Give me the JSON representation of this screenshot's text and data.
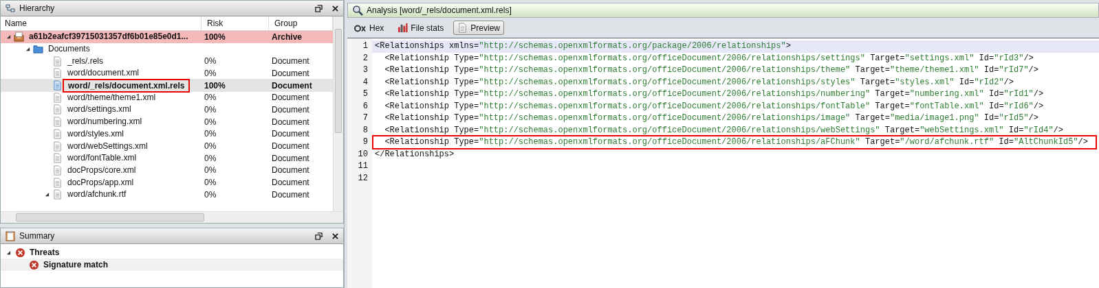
{
  "hierarchy": {
    "title": "Hierarchy",
    "columns": [
      "Name",
      "Risk",
      "Group"
    ],
    "rows": [
      {
        "name": "a61b2eafcf39715031357df6b01e85e0d1...",
        "risk": "100%",
        "group": "Archive",
        "kind": "archive",
        "alert": true,
        "selected": false,
        "highlighted": false,
        "expanded": true,
        "children": [
          {
            "name": "Documents",
            "kind": "folder",
            "alert": false,
            "selected": false,
            "highlighted": false,
            "expanded": true,
            "children": [
              {
                "name": "_rels/.rels",
                "risk": "0%",
                "group": "Document",
                "kind": "file",
                "alert": false,
                "selected": false,
                "highlighted": false
              },
              {
                "name": "word/document.xml",
                "risk": "0%",
                "group": "Document",
                "kind": "file",
                "alert": false,
                "selected": false,
                "highlighted": false
              },
              {
                "name": "word/_rels/document.xml.rels",
                "risk": "100%",
                "group": "Document",
                "kind": "file",
                "alert": false,
                "selected": true,
                "highlighted": true
              },
              {
                "name": "word/theme/theme1.xml",
                "risk": "0%",
                "group": "Document",
                "kind": "file",
                "alert": false,
                "selected": false,
                "highlighted": false
              },
              {
                "name": "word/settings.xml",
                "risk": "0%",
                "group": "Document",
                "kind": "file",
                "alert": false,
                "selected": false,
                "highlighted": false
              },
              {
                "name": "word/numbering.xml",
                "risk": "0%",
                "group": "Document",
                "kind": "file",
                "alert": false,
                "selected": false,
                "highlighted": false
              },
              {
                "name": "word/styles.xml",
                "risk": "0%",
                "group": "Document",
                "kind": "file",
                "alert": false,
                "selected": false,
                "highlighted": false
              },
              {
                "name": "word/webSettings.xml",
                "risk": "0%",
                "group": "Document",
                "kind": "file",
                "alert": false,
                "selected": false,
                "highlighted": false
              },
              {
                "name": "word/fontTable.xml",
                "risk": "0%",
                "group": "Document",
                "kind": "file",
                "alert": false,
                "selected": false,
                "highlighted": false
              },
              {
                "name": "docProps/core.xml",
                "risk": "0%",
                "group": "Document",
                "kind": "file",
                "alert": false,
                "selected": false,
                "highlighted": false
              },
              {
                "name": "docProps/app.xml",
                "risk": "0%",
                "group": "Document",
                "kind": "file",
                "alert": false,
                "selected": false,
                "highlighted": false
              },
              {
                "name": "word/afchunk.rtf",
                "risk": "0%",
                "group": "Document",
                "kind": "file",
                "alert": false,
                "selected": false,
                "highlighted": false,
                "expanded": true
              }
            ]
          }
        ]
      }
    ]
  },
  "summary": {
    "title": "Summary",
    "items": [
      {
        "label": "Threats",
        "expanded": true,
        "selected": false,
        "children": [
          {
            "label": "Signature match",
            "selected": true
          }
        ]
      }
    ]
  },
  "analysis": {
    "title": "Analysis [word/_rels/document.xml.rels]",
    "tools": [
      {
        "label": "Hex",
        "kind": "hex",
        "selected": false
      },
      {
        "label": "File stats",
        "kind": "stats",
        "selected": false
      },
      {
        "label": "Preview",
        "kind": "preview",
        "selected": true
      }
    ],
    "lines": [
      {
        "number": "1",
        "current": true,
        "highlighted": false,
        "parts": [
          {
            "kind": "markup",
            "text": "<Relationships xmlns="
          },
          {
            "kind": "string",
            "text": "\"http://schemas.openxmlformats.org/package/2006/relationships\""
          },
          {
            "kind": "markup",
            "text": ">"
          }
        ]
      },
      {
        "number": "2",
        "current": false,
        "highlighted": false,
        "parts": [
          {
            "kind": "markup",
            "text": "  <Relationship Type="
          },
          {
            "kind": "string",
            "text": "\"http://schemas.openxmlformats.org/officeDocument/2006/relationships/settings\""
          },
          {
            "kind": "markup",
            "text": " Target="
          },
          {
            "kind": "string",
            "text": "\"settings.xml\""
          },
          {
            "kind": "markup",
            "text": " Id="
          },
          {
            "kind": "string",
            "text": "\"rId3\""
          },
          {
            "kind": "markup",
            "text": "/>"
          }
        ]
      },
      {
        "number": "3",
        "current": false,
        "highlighted": false,
        "parts": [
          {
            "kind": "markup",
            "text": "  <Relationship Type="
          },
          {
            "kind": "string",
            "text": "\"http://schemas.openxmlformats.org/officeDocument/2006/relationships/theme\""
          },
          {
            "kind": "markup",
            "text": " Target="
          },
          {
            "kind": "string",
            "text": "\"theme/theme1.xml\""
          },
          {
            "kind": "markup",
            "text": " Id="
          },
          {
            "kind": "string",
            "text": "\"rId7\""
          },
          {
            "kind": "markup",
            "text": "/>"
          }
        ]
      },
      {
        "number": "4",
        "current": false,
        "highlighted": false,
        "parts": [
          {
            "kind": "markup",
            "text": "  <Relationship Type="
          },
          {
            "kind": "string",
            "text": "\"http://schemas.openxmlformats.org/officeDocument/2006/relationships/styles\""
          },
          {
            "kind": "markup",
            "text": " Target="
          },
          {
            "kind": "string",
            "text": "\"styles.xml\""
          },
          {
            "kind": "markup",
            "text": " Id="
          },
          {
            "kind": "string",
            "text": "\"rId2\""
          },
          {
            "kind": "markup",
            "text": "/>"
          }
        ]
      },
      {
        "number": "5",
        "current": false,
        "highlighted": false,
        "parts": [
          {
            "kind": "markup",
            "text": "  <Relationship Type="
          },
          {
            "kind": "string",
            "text": "\"http://schemas.openxmlformats.org/officeDocument/2006/relationships/numbering\""
          },
          {
            "kind": "markup",
            "text": " Target="
          },
          {
            "kind": "string",
            "text": "\"numbering.xml\""
          },
          {
            "kind": "markup",
            "text": " Id="
          },
          {
            "kind": "string",
            "text": "\"rId1\""
          },
          {
            "kind": "markup",
            "text": "/>"
          }
        ]
      },
      {
        "number": "6",
        "current": false,
        "highlighted": false,
        "parts": [
          {
            "kind": "markup",
            "text": "  <Relationship Type="
          },
          {
            "kind": "string",
            "text": "\"http://schemas.openxmlformats.org/officeDocument/2006/relationships/fontTable\""
          },
          {
            "kind": "markup",
            "text": " Target="
          },
          {
            "kind": "string",
            "text": "\"fontTable.xml\""
          },
          {
            "kind": "markup",
            "text": " Id="
          },
          {
            "kind": "string",
            "text": "\"rId6\""
          },
          {
            "kind": "markup",
            "text": "/>"
          }
        ]
      },
      {
        "number": "7",
        "current": false,
        "highlighted": false,
        "parts": [
          {
            "kind": "markup",
            "text": "  <Relationship Type="
          },
          {
            "kind": "string",
            "text": "\"http://schemas.openxmlformats.org/officeDocument/2006/relationships/image\""
          },
          {
            "kind": "markup",
            "text": " Target="
          },
          {
            "kind": "string",
            "text": "\"media/image1.png\""
          },
          {
            "kind": "markup",
            "text": " Id="
          },
          {
            "kind": "string",
            "text": "\"rId5\""
          },
          {
            "kind": "markup",
            "text": "/>"
          }
        ]
      },
      {
        "number": "8",
        "current": false,
        "highlighted": false,
        "parts": [
          {
            "kind": "markup",
            "text": "  <Relationship Type="
          },
          {
            "kind": "string",
            "text": "\"http://schemas.openxmlformats.org/officeDocument/2006/relationships/webSettings\""
          },
          {
            "kind": "markup",
            "text": " Target="
          },
          {
            "kind": "string",
            "text": "\"webSettings.xml\""
          },
          {
            "kind": "markup",
            "text": " Id="
          },
          {
            "kind": "string",
            "text": "\"rId4\""
          },
          {
            "kind": "markup",
            "text": "/>"
          }
        ]
      },
      {
        "number": "9",
        "current": false,
        "highlighted": true,
        "parts": [
          {
            "kind": "markup",
            "text": "  <Relationship Type="
          },
          {
            "kind": "string",
            "text": "\"http://schemas.openxmlformats.org/officeDocument/2006/relationships/aFChunk\""
          },
          {
            "kind": "markup",
            "text": " Target="
          },
          {
            "kind": "string",
            "text": "\"/word/afchunk.rtf\""
          },
          {
            "kind": "markup",
            "text": " Id="
          },
          {
            "kind": "string",
            "text": "\"AltChunkId5\""
          },
          {
            "kind": "markup",
            "text": "/>"
          }
        ]
      },
      {
        "number": "10",
        "current": false,
        "highlighted": false,
        "parts": [
          {
            "kind": "markup",
            "text": "</Relationships>"
          }
        ]
      },
      {
        "number": "11",
        "current": false,
        "highlighted": false
      },
      {
        "number": "12",
        "current": false,
        "highlighted": false
      }
    ]
  }
}
